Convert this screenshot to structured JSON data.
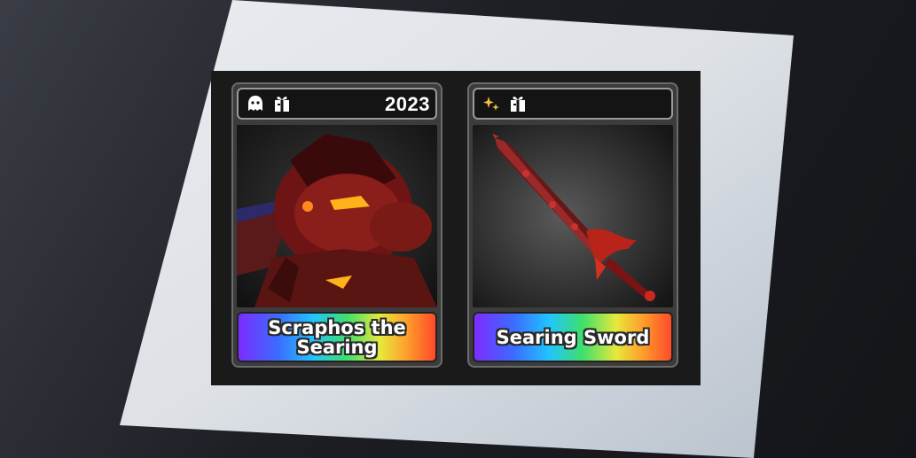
{
  "items": [
    {
      "year": "2023",
      "name": "Scraphos the\nSearing",
      "icons": [
        "ghost-icon",
        "gift-box-icon"
      ]
    },
    {
      "year": "",
      "name": "Searing Sword",
      "icons": [
        "sparkle-icon",
        "gift-box-icon"
      ]
    }
  ],
  "colors": {
    "frame": "#1a1a1a",
    "card": "#3c3c3c",
    "header": "#141414",
    "sparkle": "#f2c23a"
  }
}
